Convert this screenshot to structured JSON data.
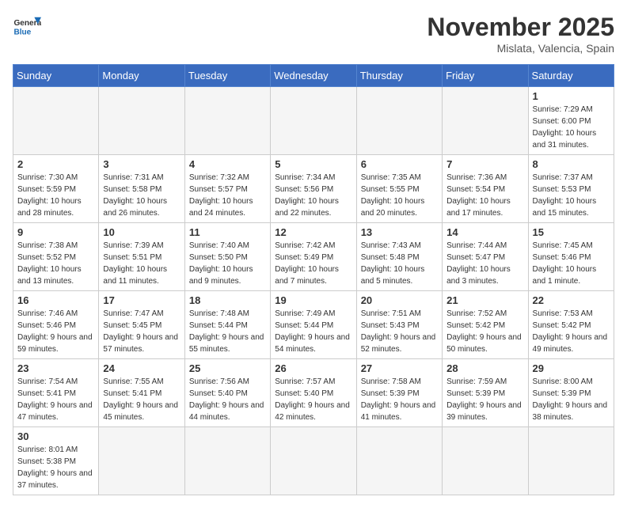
{
  "logo": {
    "line1": "General",
    "line2": "Blue"
  },
  "title": "November 2025",
  "location": "Mislata, Valencia, Spain",
  "weekdays": [
    "Sunday",
    "Monday",
    "Tuesday",
    "Wednesday",
    "Thursday",
    "Friday",
    "Saturday"
  ],
  "weeks": [
    [
      {
        "day": "",
        "info": ""
      },
      {
        "day": "",
        "info": ""
      },
      {
        "day": "",
        "info": ""
      },
      {
        "day": "",
        "info": ""
      },
      {
        "day": "",
        "info": ""
      },
      {
        "day": "",
        "info": ""
      },
      {
        "day": "1",
        "info": "Sunrise: 7:29 AM\nSunset: 6:00 PM\nDaylight: 10 hours and 31 minutes."
      }
    ],
    [
      {
        "day": "2",
        "info": "Sunrise: 7:30 AM\nSunset: 5:59 PM\nDaylight: 10 hours and 28 minutes."
      },
      {
        "day": "3",
        "info": "Sunrise: 7:31 AM\nSunset: 5:58 PM\nDaylight: 10 hours and 26 minutes."
      },
      {
        "day": "4",
        "info": "Sunrise: 7:32 AM\nSunset: 5:57 PM\nDaylight: 10 hours and 24 minutes."
      },
      {
        "day": "5",
        "info": "Sunrise: 7:34 AM\nSunset: 5:56 PM\nDaylight: 10 hours and 22 minutes."
      },
      {
        "day": "6",
        "info": "Sunrise: 7:35 AM\nSunset: 5:55 PM\nDaylight: 10 hours and 20 minutes."
      },
      {
        "day": "7",
        "info": "Sunrise: 7:36 AM\nSunset: 5:54 PM\nDaylight: 10 hours and 17 minutes."
      },
      {
        "day": "8",
        "info": "Sunrise: 7:37 AM\nSunset: 5:53 PM\nDaylight: 10 hours and 15 minutes."
      }
    ],
    [
      {
        "day": "9",
        "info": "Sunrise: 7:38 AM\nSunset: 5:52 PM\nDaylight: 10 hours and 13 minutes."
      },
      {
        "day": "10",
        "info": "Sunrise: 7:39 AM\nSunset: 5:51 PM\nDaylight: 10 hours and 11 minutes."
      },
      {
        "day": "11",
        "info": "Sunrise: 7:40 AM\nSunset: 5:50 PM\nDaylight: 10 hours and 9 minutes."
      },
      {
        "day": "12",
        "info": "Sunrise: 7:42 AM\nSunset: 5:49 PM\nDaylight: 10 hours and 7 minutes."
      },
      {
        "day": "13",
        "info": "Sunrise: 7:43 AM\nSunset: 5:48 PM\nDaylight: 10 hours and 5 minutes."
      },
      {
        "day": "14",
        "info": "Sunrise: 7:44 AM\nSunset: 5:47 PM\nDaylight: 10 hours and 3 minutes."
      },
      {
        "day": "15",
        "info": "Sunrise: 7:45 AM\nSunset: 5:46 PM\nDaylight: 10 hours and 1 minute."
      }
    ],
    [
      {
        "day": "16",
        "info": "Sunrise: 7:46 AM\nSunset: 5:46 PM\nDaylight: 9 hours and 59 minutes."
      },
      {
        "day": "17",
        "info": "Sunrise: 7:47 AM\nSunset: 5:45 PM\nDaylight: 9 hours and 57 minutes."
      },
      {
        "day": "18",
        "info": "Sunrise: 7:48 AM\nSunset: 5:44 PM\nDaylight: 9 hours and 55 minutes."
      },
      {
        "day": "19",
        "info": "Sunrise: 7:49 AM\nSunset: 5:44 PM\nDaylight: 9 hours and 54 minutes."
      },
      {
        "day": "20",
        "info": "Sunrise: 7:51 AM\nSunset: 5:43 PM\nDaylight: 9 hours and 52 minutes."
      },
      {
        "day": "21",
        "info": "Sunrise: 7:52 AM\nSunset: 5:42 PM\nDaylight: 9 hours and 50 minutes."
      },
      {
        "day": "22",
        "info": "Sunrise: 7:53 AM\nSunset: 5:42 PM\nDaylight: 9 hours and 49 minutes."
      }
    ],
    [
      {
        "day": "23",
        "info": "Sunrise: 7:54 AM\nSunset: 5:41 PM\nDaylight: 9 hours and 47 minutes."
      },
      {
        "day": "24",
        "info": "Sunrise: 7:55 AM\nSunset: 5:41 PM\nDaylight: 9 hours and 45 minutes."
      },
      {
        "day": "25",
        "info": "Sunrise: 7:56 AM\nSunset: 5:40 PM\nDaylight: 9 hours and 44 minutes."
      },
      {
        "day": "26",
        "info": "Sunrise: 7:57 AM\nSunset: 5:40 PM\nDaylight: 9 hours and 42 minutes."
      },
      {
        "day": "27",
        "info": "Sunrise: 7:58 AM\nSunset: 5:39 PM\nDaylight: 9 hours and 41 minutes."
      },
      {
        "day": "28",
        "info": "Sunrise: 7:59 AM\nSunset: 5:39 PM\nDaylight: 9 hours and 39 minutes."
      },
      {
        "day": "29",
        "info": "Sunrise: 8:00 AM\nSunset: 5:39 PM\nDaylight: 9 hours and 38 minutes."
      }
    ],
    [
      {
        "day": "30",
        "info": "Sunrise: 8:01 AM\nSunset: 5:38 PM\nDaylight: 9 hours and 37 minutes."
      },
      {
        "day": "",
        "info": ""
      },
      {
        "day": "",
        "info": ""
      },
      {
        "day": "",
        "info": ""
      },
      {
        "day": "",
        "info": ""
      },
      {
        "day": "",
        "info": ""
      },
      {
        "day": "",
        "info": ""
      }
    ]
  ]
}
